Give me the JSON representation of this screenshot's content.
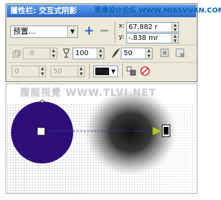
{
  "propbar": {
    "title": "屬性栏: 交互式阴影",
    "watermark": "思缘设计论坛 WWW.MISSVUAN.COM",
    "preset": {
      "value": "预置..."
    },
    "coords": {
      "x_label": "x:",
      "x_value": "67.882 r",
      "y_label": "y:",
      "y_value": "-.838 mr"
    },
    "row2": {
      "angle_value": "-8",
      "opacity_value": "100",
      "feather_value": "50"
    },
    "row3": {
      "stretch_value": "0",
      "fade_value": "50"
    }
  },
  "canvas": {
    "watermark": "騰龍視覺 WWW.TLVI.NET",
    "circle_color": "#2e0f78",
    "arrow_color": "#b5c832"
  }
}
